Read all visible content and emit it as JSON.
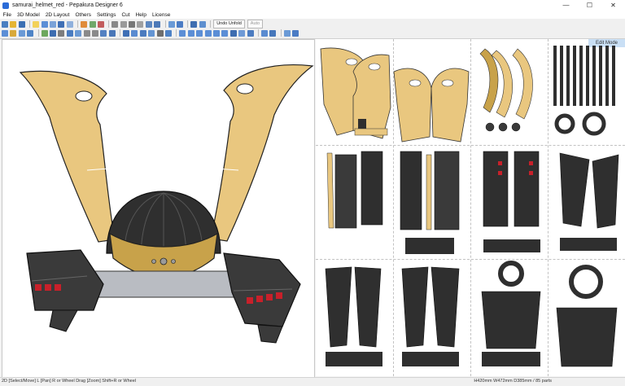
{
  "window": {
    "title": "samurai_helmet_red - Pepakura Designer 6",
    "buttons": {
      "minimize": "—",
      "maximize": "☐",
      "close": "✕"
    }
  },
  "menu": [
    "File",
    "3D Model",
    "2D Layout",
    "Others",
    "Settings",
    "Cut",
    "Help",
    "License"
  ],
  "toolbar": {
    "undo_unfold_label": "Undo Unfold",
    "auto_label": "Auto"
  },
  "layout_pane": {
    "mode_label": "Edit Mode"
  },
  "status": {
    "hint": "2D [Select/Move] L [Pan] R or Wheel Drag [Zoom] Shift+R or Wheel",
    "info": "H420mm W472mm D385mm / 85 parts"
  },
  "colors": {
    "gold": "#e9c77f",
    "gold_dark": "#c8a24a",
    "armor": "#3a3a3a",
    "armor_dark": "#242424",
    "red": "#c8202a",
    "silver": "#b9bcc2"
  }
}
